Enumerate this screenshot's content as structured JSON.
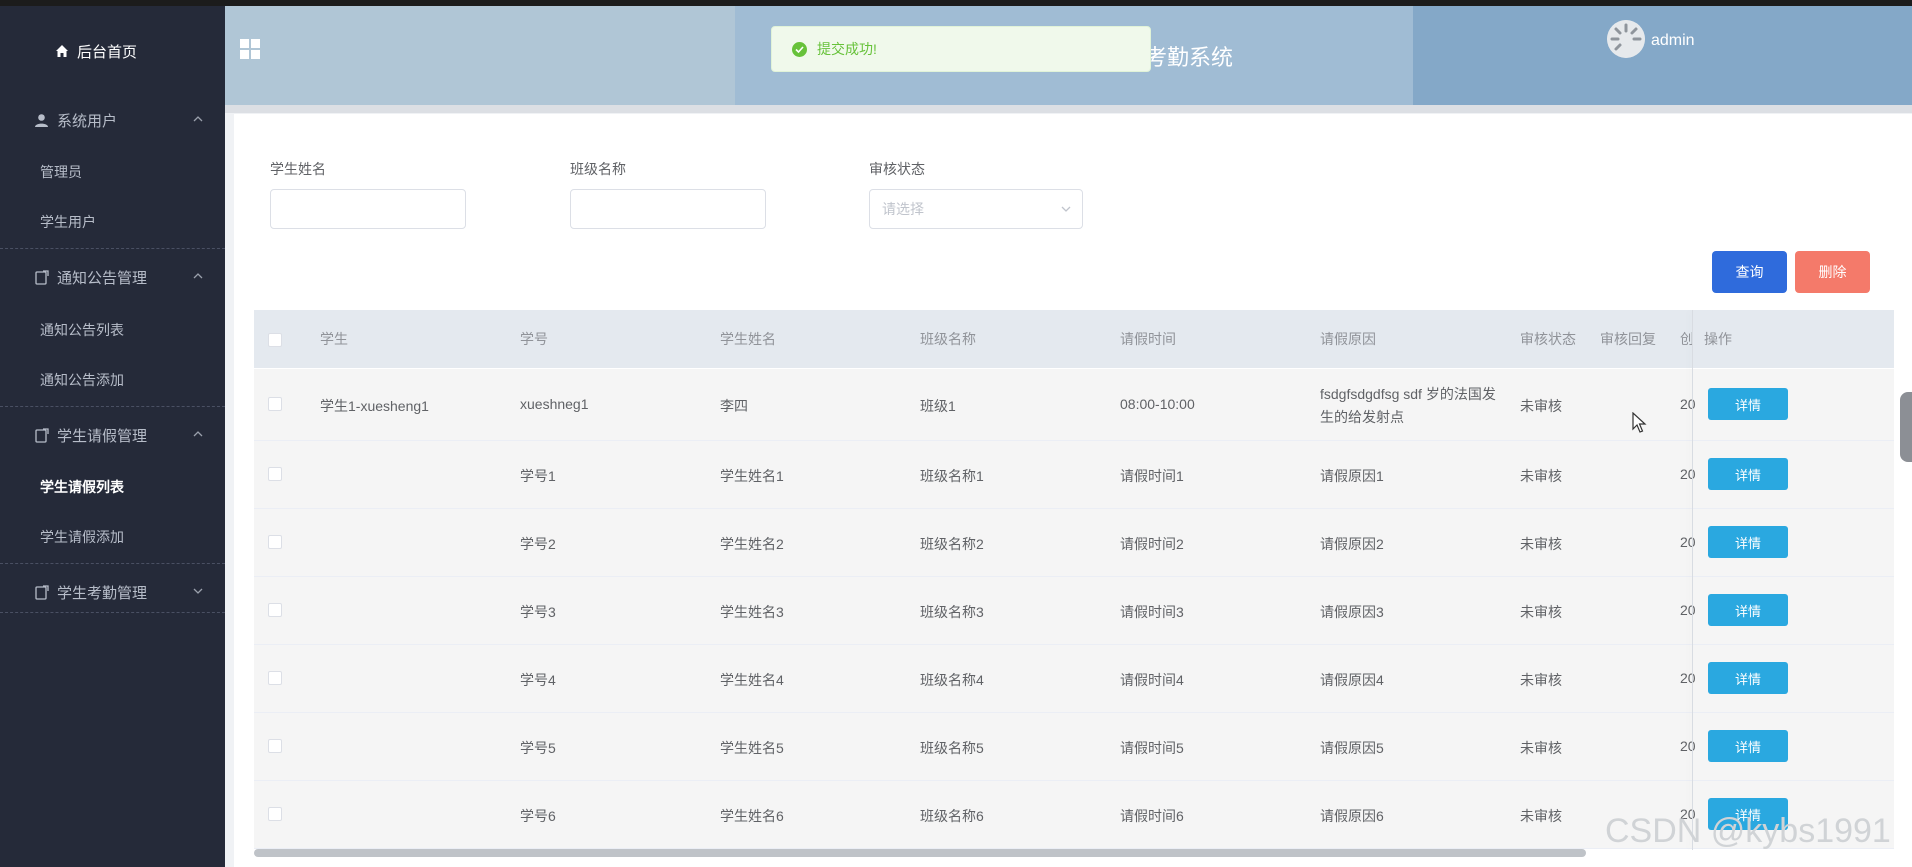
{
  "sidebar": {
    "home": "后台首页",
    "groups": [
      {
        "label": "系统用户",
        "items": [
          "管理员",
          "学生用户"
        ]
      },
      {
        "label": "通知公告管理",
        "items": [
          "通知公告列表",
          "通知公告添加"
        ]
      },
      {
        "label": "学生请假管理",
        "items": [
          "学生请假列表",
          "学生请假添加"
        ]
      },
      {
        "label": "学生考勤管理",
        "items": []
      }
    ],
    "active_item": "学生请假列表"
  },
  "header": {
    "title_visible": "考勤系统",
    "user": "admin"
  },
  "toast": {
    "message": "提交成功!",
    "type": "success"
  },
  "filters": {
    "student_name_label": "学生姓名",
    "class_name_label": "班级名称",
    "status_label": "审核状态",
    "status_placeholder": "请选择"
  },
  "buttons": {
    "query": "查询",
    "delete": "删除",
    "detail": "详情"
  },
  "table": {
    "columns": [
      "学生",
      "学号",
      "学生姓名",
      "班级名称",
      "请假时间",
      "请假原因",
      "审核状态",
      "审核回复",
      "创",
      "操作"
    ],
    "rows": [
      {
        "student": "学生1-xuesheng1",
        "no": "xueshneg1",
        "name": "李四",
        "class": "班级1",
        "time": "08:00-10:00",
        "reason_l1": "fsdgfsdgdfsg sdf 岁的法国发",
        "reason_l2": "生的给发射点",
        "status": "未审核",
        "created": "20"
      },
      {
        "student": "",
        "no": "学号1",
        "name": "学生姓名1",
        "class": "班级名称1",
        "time": "请假时间1",
        "reason_l1": "请假原因1",
        "reason_l2": "",
        "status": "未审核",
        "created": "20"
      },
      {
        "student": "",
        "no": "学号2",
        "name": "学生姓名2",
        "class": "班级名称2",
        "time": "请假时间2",
        "reason_l1": "请假原因2",
        "reason_l2": "",
        "status": "未审核",
        "created": "20"
      },
      {
        "student": "",
        "no": "学号3",
        "name": "学生姓名3",
        "class": "班级名称3",
        "time": "请假时间3",
        "reason_l1": "请假原因3",
        "reason_l2": "",
        "status": "未审核",
        "created": "20"
      },
      {
        "student": "",
        "no": "学号4",
        "name": "学生姓名4",
        "class": "班级名称4",
        "time": "请假时间4",
        "reason_l1": "请假原因4",
        "reason_l2": "",
        "status": "未审核",
        "created": "20"
      },
      {
        "student": "",
        "no": "学号5",
        "name": "学生姓名5",
        "class": "班级名称5",
        "time": "请假时间5",
        "reason_l1": "请假原因5",
        "reason_l2": "",
        "status": "未审核",
        "created": "20"
      },
      {
        "student": "",
        "no": "学号6",
        "name": "学生姓名6",
        "class": "班级名称6",
        "time": "请假时间6",
        "reason_l1": "请假原因6",
        "reason_l2": "",
        "status": "未审核",
        "created": "20"
      }
    ]
  },
  "watermark": "CSDN @kybs1991",
  "colors": {
    "sidebar_bg": "#252a39",
    "header_bg": "#b0c6d6",
    "query_btn": "#2f6bdc",
    "delete_btn": "#f47a6a",
    "detail_btn": "#2aa8e0",
    "success": "#67c23a"
  }
}
